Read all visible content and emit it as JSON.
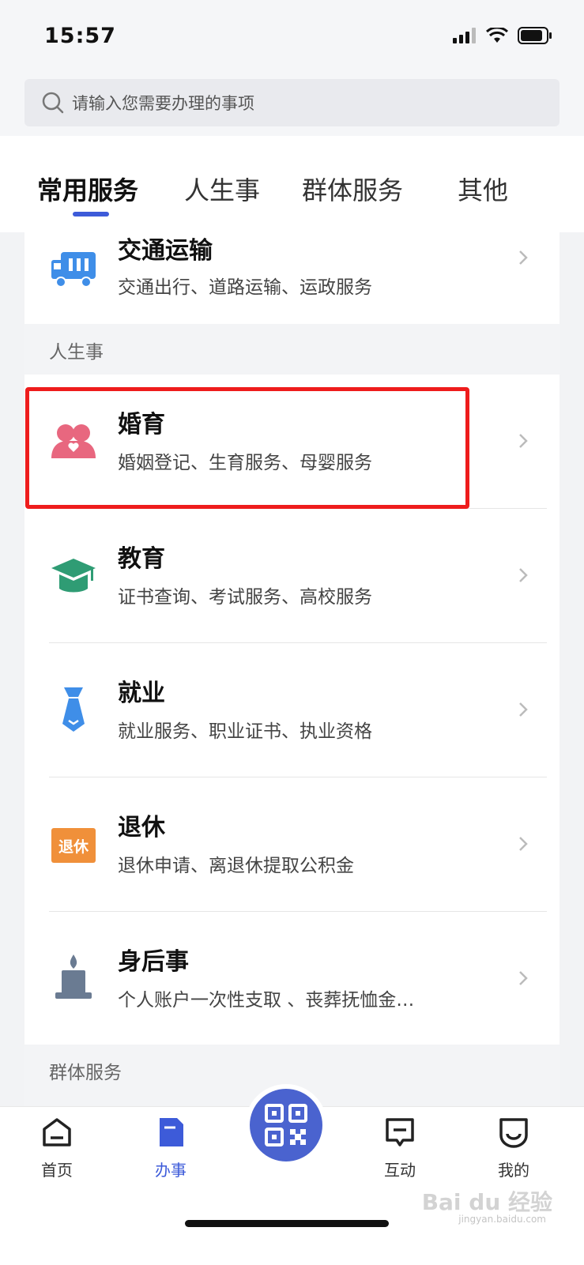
{
  "status_bar": {
    "time": "15:57"
  },
  "search": {
    "placeholder": "请输入您需要办理的事项"
  },
  "tabs": [
    {
      "label": "常用服务",
      "active": true
    },
    {
      "label": "人生事",
      "active": false
    },
    {
      "label": "群体服务",
      "active": false
    },
    {
      "label": "其他",
      "active": false
    }
  ],
  "services": {
    "transport": {
      "title": "交通运输",
      "subtitle": "交通出行、道路运输、运政服务"
    },
    "section_life": "人生事",
    "marriage": {
      "title": "婚育",
      "subtitle": "婚姻登记、生育服务、母婴服务"
    },
    "education": {
      "title": "教育",
      "subtitle": "证书查询、考试服务、高校服务"
    },
    "employment": {
      "title": "就业",
      "subtitle": "就业服务、职业证书、执业资格"
    },
    "retirement": {
      "title": "退休",
      "subtitle": "退休申请、离退休提取公积金",
      "icon_text": "退休"
    },
    "afterlife": {
      "title": "身后事",
      "subtitle": "个人账户一次性支取 、丧葬抚恤金…"
    },
    "section_group": "群体服务"
  },
  "bottom_nav": [
    {
      "label": "首页",
      "icon": "home-icon",
      "active": false
    },
    {
      "label": "办事",
      "icon": "document-icon",
      "active": true
    },
    {
      "label": "互动",
      "icon": "message-icon",
      "active": false
    },
    {
      "label": "我的",
      "icon": "profile-icon",
      "active": false
    }
  ],
  "watermark": {
    "text": "Bai du 经验",
    "url_text": "jingyan.baidu.com"
  },
  "colors": {
    "accent": "#3d5bd9",
    "highlight": "#ee1c1c",
    "marriage": "#e8677f",
    "education": "#2f9c74",
    "employment": "#3f8ee8",
    "retirement": "#f0903a",
    "afterlife": "#6a7b92"
  }
}
